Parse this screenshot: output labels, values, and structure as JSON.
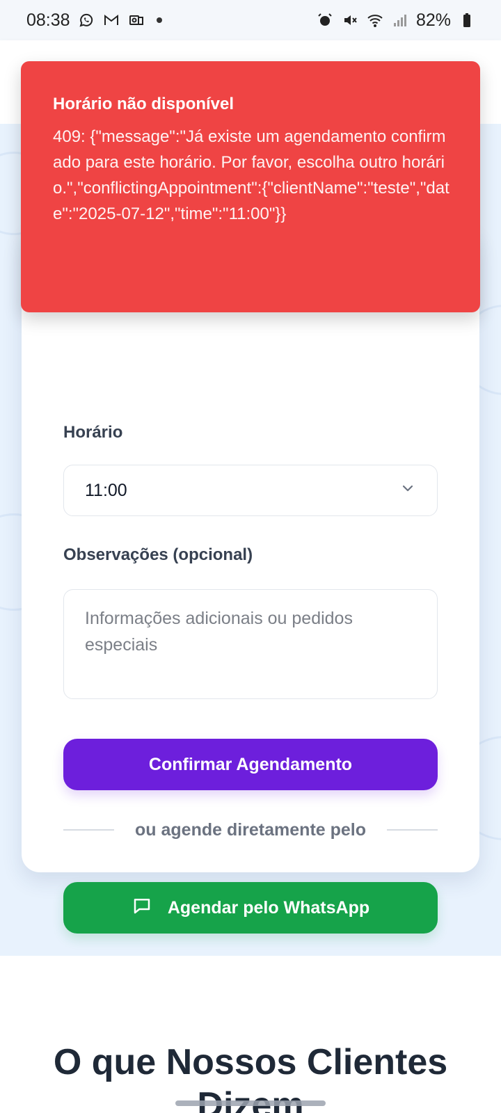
{
  "status_bar": {
    "time": "08:38",
    "battery": "82%",
    "left_icons": [
      "whatsapp-icon",
      "gmail-icon",
      "outlook-icon"
    ],
    "right_icons": [
      "alarm-icon",
      "mute-icon",
      "wifi-icon",
      "signal-icon",
      "battery-icon"
    ]
  },
  "toast": {
    "title": "Horário não disponível",
    "message": "409: {\"message\":\"Já existe um agendamento confirmado para este horário. Por favor, escolha outro horário.\",\"conflictingAppointment\":{\"clientName\":\"teste\",\"date\":\"2025-07-12\",\"time\":\"11:00\"}}",
    "background": "#ef4444"
  },
  "form": {
    "time_label": "Horário",
    "time_value": "11:00",
    "notes_label": "Observações (opcional)",
    "notes_placeholder": "Informações adicionais ou pedidos especiais",
    "confirm_label": "Confirmar Agendamento",
    "divider_text": "ou agende diretamente pelo",
    "whatsapp_label": "Agendar pelo WhatsApp"
  },
  "testimonials": {
    "title": "O que Nossos Clientes Dizem"
  },
  "colors": {
    "primary": "#6d1fdc",
    "whatsapp": "#16a34a",
    "section_bg": "#e8f2fd"
  }
}
